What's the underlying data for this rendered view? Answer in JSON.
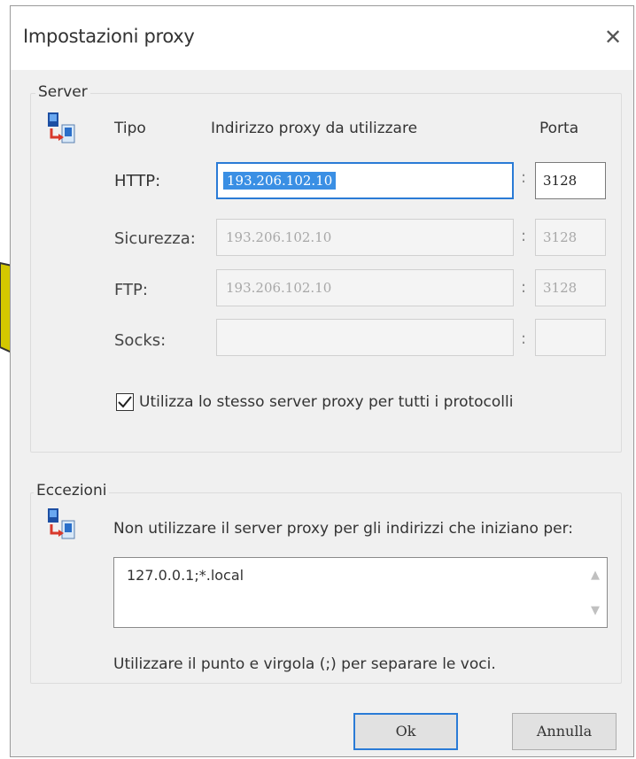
{
  "dialog": {
    "title": "Impostazioni proxy",
    "close_glyph": "✕"
  },
  "server": {
    "group_label": "Server",
    "icon": "network-computers-icon",
    "headers": {
      "type": "Tipo",
      "address": "Indirizzo proxy da utilizzare",
      "port": "Porta"
    },
    "rows": [
      {
        "label": "HTTP:",
        "address": "193.206.102.10",
        "port": "3128",
        "active": true
      },
      {
        "label": "Sicurezza:",
        "address": "193.206.102.10",
        "port": "3128"
      },
      {
        "label": "FTP:",
        "address": "193.206.102.10",
        "port": "3128"
      },
      {
        "label": "Socks:",
        "address": "",
        "port": ""
      }
    ],
    "colon": ":",
    "same_proxy": {
      "label": "Utilizza lo stesso server proxy per tutti i protocolli",
      "checked": true
    }
  },
  "exceptions": {
    "group_label": "Eccezioni",
    "icon": "network-computers-icon",
    "description": "Non utilizzare il server proxy per gli indirizzi che iniziano per:",
    "value": "127.0.0.1;*.local",
    "hint": "Utilizzare il punto e virgola (;) per separare le voci."
  },
  "buttons": {
    "ok": "Ok",
    "cancel": "Annulla"
  },
  "colors": {
    "accent": "#2a7bd6",
    "selection": "#3a8fe4",
    "arrow": "#d4c800"
  }
}
